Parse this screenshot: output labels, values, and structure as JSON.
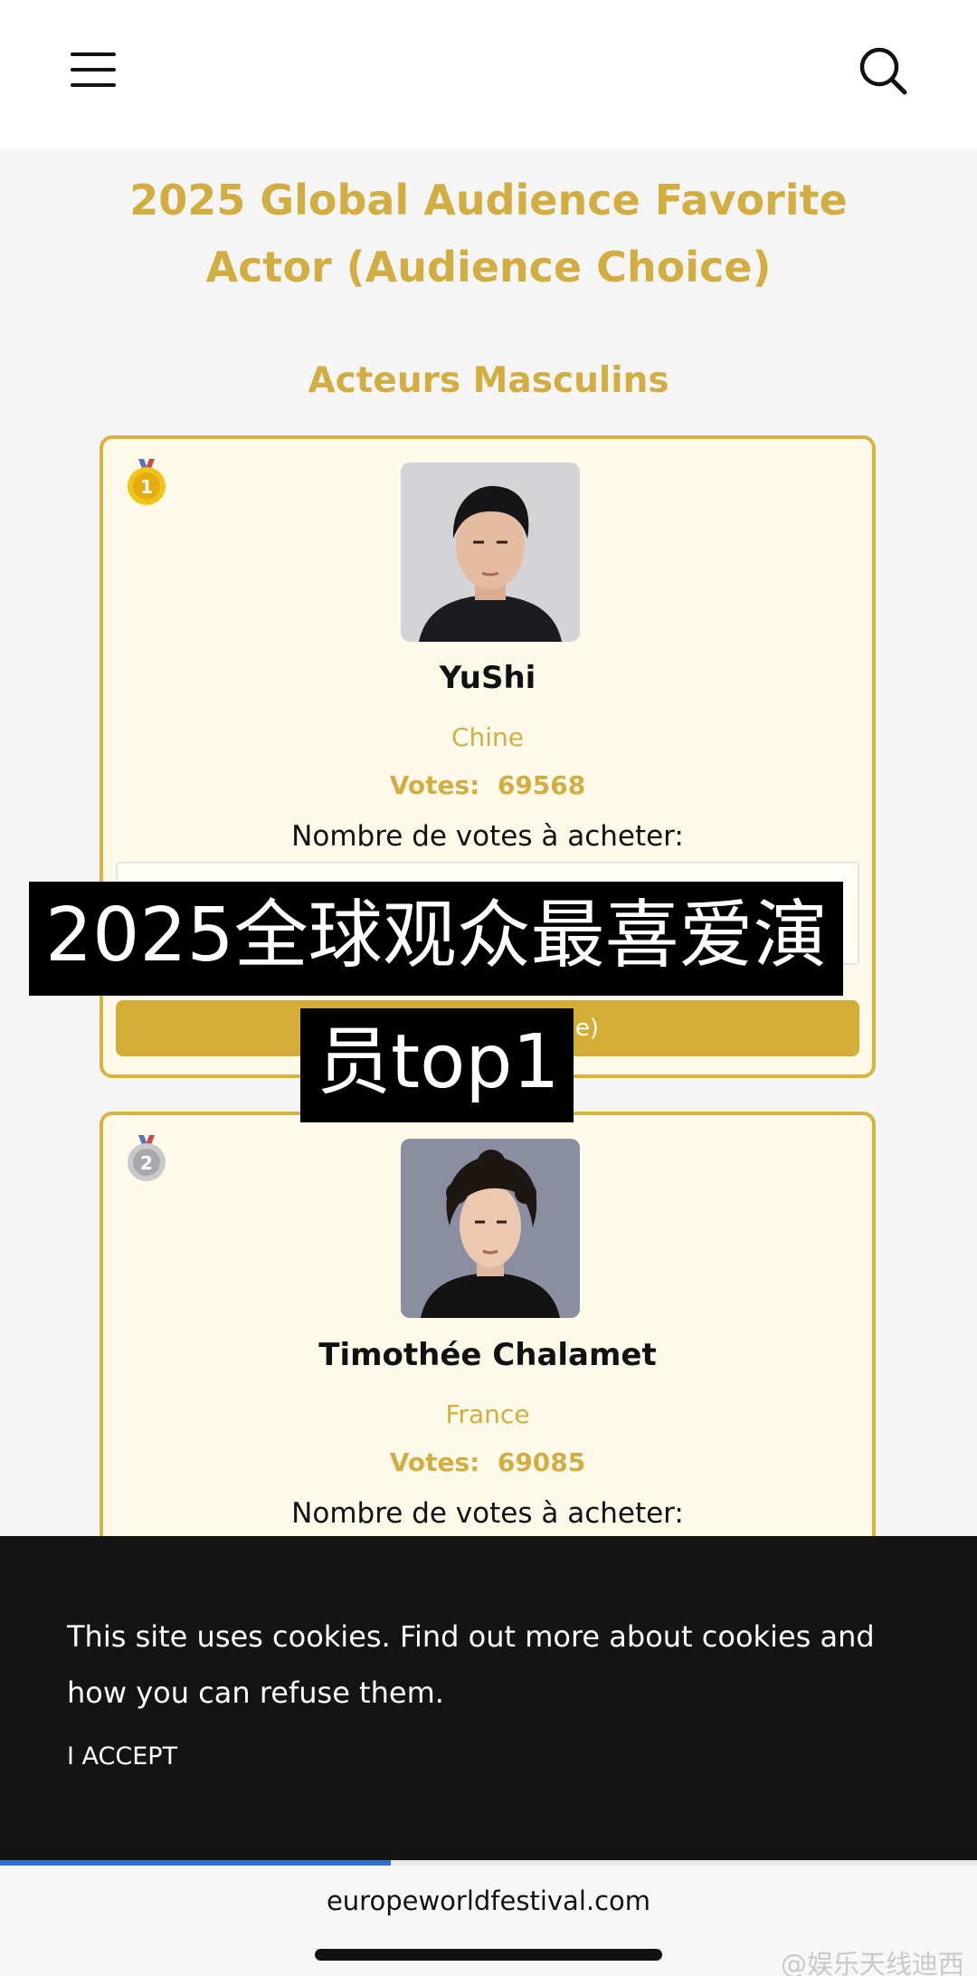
{
  "header": {
    "menu_icon": "hamburger-menu-icon",
    "search_icon": "search-icon"
  },
  "page": {
    "title_line1": "2025 Global Audience Favorite",
    "title_line2": "Actor (Audience Choice)",
    "section_title": "Acteurs Masculins",
    "accent_color": "#d2ae42"
  },
  "cards": [
    {
      "rank": "1",
      "medal": "gold-medal-icon",
      "name": "YuShi",
      "country": "Chine",
      "votes_label": "Votes:",
      "votes_value": "69568",
      "buy_label": "Nombre de votes à acheter:",
      "button_label_visible": "e)"
    },
    {
      "rank": "2",
      "medal": "silver-medal-icon",
      "name": "Timothée Chalamet",
      "country": "France",
      "votes_label": "Votes:",
      "votes_value": "69085",
      "buy_label": "Nombre de votes à acheter:"
    }
  ],
  "overlay_caption": {
    "line1": "2025全球观众最喜爱演",
    "line2": "员top1"
  },
  "cookie_banner": {
    "text": "This site uses cookies. Find out more about cookies and how you can refuse them.",
    "accept_label": "I ACCEPT"
  },
  "browser": {
    "url": "europeworldfestival.com",
    "load_progress": 0.4
  },
  "watermark": {
    "text": "@娱乐天线迪西"
  }
}
